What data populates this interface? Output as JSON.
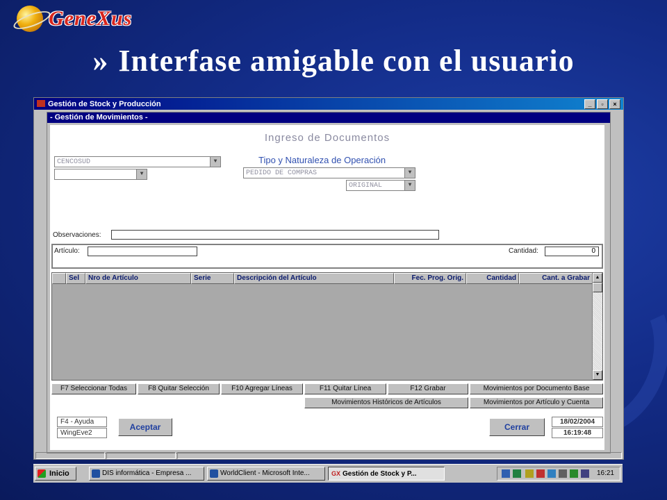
{
  "logo": {
    "text": "GeneXus"
  },
  "slide": {
    "bullet": "»",
    "title": "Interfase amigable con el usuario"
  },
  "main_window": {
    "title": "Gestión de Stock y Producción",
    "min": "_",
    "max": "▫",
    "close": "×"
  },
  "child_window": {
    "title": "- Gestión de Movimientos -",
    "heading": "Ingreso de Documentos",
    "operation_heading": "Tipo y Naturaleza de Operación",
    "company_combo": "CENCOSUD",
    "second_combo": "",
    "operation_combo": "PEDIDO DE COMPRAS",
    "nature_combo": "ORIGINAL",
    "observaciones_label": "Observaciones:",
    "observaciones_value": "",
    "articulo_label": "Artículo:",
    "articulo_value": "",
    "cantidad_label": "Cantidad:",
    "cantidad_value": "0",
    "grid": {
      "columns": [
        "Sel",
        "Nro de Artículo",
        "Serie",
        "Descripción del Artículo",
        "Fec. Prog. Orig.",
        "Cantidad",
        "Cant. a Grabar"
      ]
    },
    "buttons_row1": [
      "F7 Seleccionar Todas",
      "F8 Quitar Selección",
      "F10 Agregar Líneas",
      "F11 Quitar Línea",
      "F12 Grabar",
      "Movimientos por Documento Base"
    ],
    "buttons_row2": [
      "Movimientos Históricos de Artículos",
      "Movimientos por Artículo y Cuenta"
    ],
    "help_label": "F4 - Ayuda",
    "program_name": "WingEve2",
    "accept_button": "Aceptar",
    "close_button": "Cerrar",
    "date": "18/02/2004",
    "time": "16:19:48"
  },
  "taskbar": {
    "start": "Inicio",
    "items": [
      "DIS informática - Empresa ...",
      "WorldClient - Microsoft Inte...",
      "Gestión de Stock y P..."
    ],
    "active_prefix": "GX",
    "clock": "16:21"
  }
}
